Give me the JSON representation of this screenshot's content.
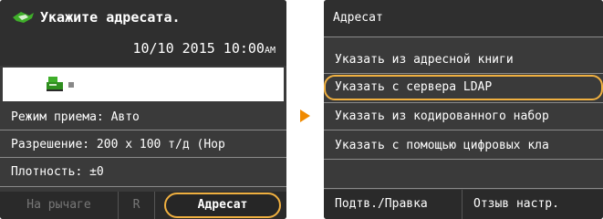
{
  "left_screen": {
    "prompt": "Укажите адресата.",
    "date_time": "10/10 2015 10:00",
    "am_pm": "AM",
    "rows": [
      "Режим приема: Авто",
      "Разрешение: 200 x 100 т/д (Нор",
      "Плотность: ±0"
    ],
    "tabs": {
      "on_hook": "На рычаге",
      "r": "R",
      "recipient": "Адресат"
    }
  },
  "right_screen": {
    "title": "Адресат",
    "menu_items": [
      "Указать из адресной книги",
      "Указать с сервера LDAP",
      "Указать из кодированного набор",
      "Указать с помощью цифровых кла"
    ],
    "bottom_buttons": {
      "confirm_edit": "Подтв./Правка",
      "recall_settings": "Отзыв настр."
    }
  },
  "colors": {
    "highlight": "#f0b040",
    "arrow": "#f08a00",
    "screen_bg": "#3a3a3a"
  },
  "icons": {
    "recipient": "recipient-bird-icon",
    "fax": "fax-icon",
    "arrow": "next-arrow-icon"
  }
}
